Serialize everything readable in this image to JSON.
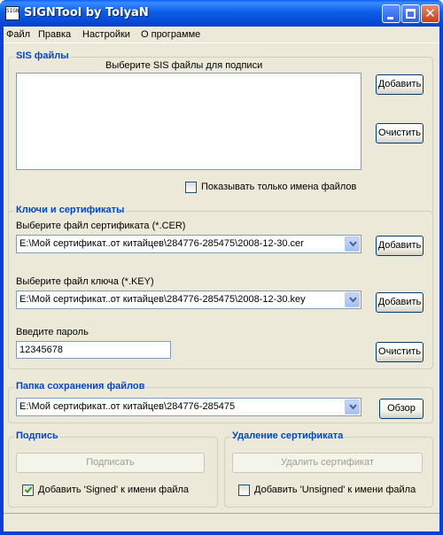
{
  "window": {
    "title": "SIGNTool by TolyaN",
    "icon_text": "SIGN"
  },
  "menu": [
    "Файл",
    "Правка",
    "Настройки",
    "О программе"
  ],
  "sis_files": {
    "group_title": "SIS файлы",
    "prompt": "Выберите SIS файлы для подписи",
    "add_button": "Добавить",
    "clear_button": "Очистить",
    "show_names_only_label": "Показывать только имена файлов",
    "show_names_only_checked": false
  },
  "keys": {
    "group_title": "Ключи и сертификаты",
    "cert_label": "Выберите файл сертификата (*.CER)",
    "cert_value": "E:\\Мой сертификат..от китайцев\\284776-285475\\2008-12-30.cer",
    "cert_add_button": "Добавить",
    "key_label": "Выберите файл ключа (*.KEY)",
    "key_value": "E:\\Мой сертификат..от китайцев\\284776-285475\\2008-12-30.key",
    "key_add_button": "Добавить",
    "password_label": "Введите пароль",
    "password_value": "12345678",
    "clear_button": "Очистить"
  },
  "output": {
    "group_title": "Папка сохранения файлов",
    "folder_value": "E:\\Мой сертификат..от китайцев\\284776-285475",
    "browse_button": "Обзор"
  },
  "sign": {
    "group_title": "Подпись",
    "sign_button": "Подписать",
    "add_signed_label": "Добавить 'Signed' к имени файла",
    "add_signed_checked": true
  },
  "unsign": {
    "group_title": "Удаление сертификата",
    "remove_button": "Удалить сертификат",
    "add_unsigned_label": "Добавить 'Unsigned' к имени файла",
    "add_unsigned_checked": false
  },
  "colors": {
    "titlebar": "#0a5df8",
    "group_title": "#0046d5",
    "face": "#ece9d8"
  }
}
